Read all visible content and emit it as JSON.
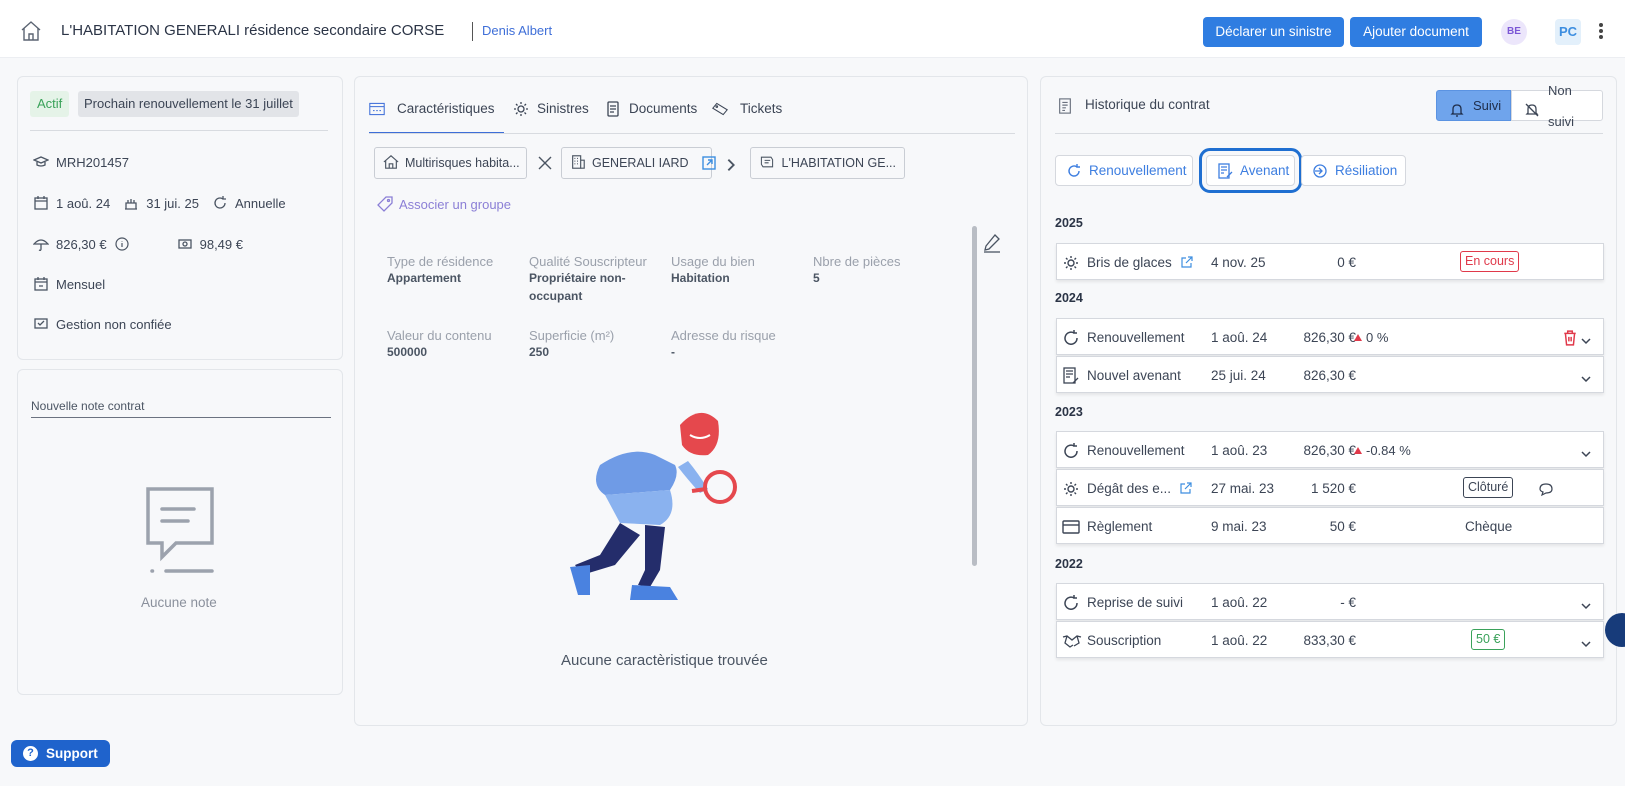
{
  "header": {
    "title": "L'HABITATION GENERALI résidence secondaire CORSE",
    "client": "Denis Albert",
    "declare_button": "Déclarer un sinistre",
    "add_doc_button": "Ajouter document",
    "avatar_1": "BE",
    "avatar_2": "PC"
  },
  "summary": {
    "status": "Actif",
    "renewal": "Prochain renouvellement le 31 juillet",
    "contract_number": "MRH201457",
    "start_date": "1 aoû. 24",
    "end_date": "31 jui. 25",
    "periodicity": "Annuelle",
    "premium": "826,30 €",
    "fees": "98,49 €",
    "payment": "Mensuel",
    "management": "Gestion non confiée"
  },
  "notes": {
    "placeholder": "Nouvelle note contrat",
    "empty": "Aucune note"
  },
  "tabs": [
    {
      "label": "Caractéristiques",
      "icon": "characteristics-icon"
    },
    {
      "label": "Sinistres",
      "icon": "gear-icon"
    },
    {
      "label": "Documents",
      "icon": "document-icon"
    },
    {
      "label": "Tickets",
      "icon": "ticket-icon"
    }
  ],
  "chips": {
    "product": "Multirisques habita...",
    "insurer": "GENERALI IARD",
    "contract": "L'HABITATION GE..."
  },
  "associate_group": "Associer un groupe",
  "fields": [
    {
      "label": "Type de résidence",
      "value": "Appartement"
    },
    {
      "label": "Qualité Souscripteur",
      "value": "Propriétaire non-occupant"
    },
    {
      "label": "Usage du bien",
      "value": "Habitation"
    },
    {
      "label": "Nbre de pièces",
      "value": "5"
    },
    {
      "label": "Valeur du contenu",
      "value": "500000"
    },
    {
      "label": "Superficie (m²)",
      "value": "250"
    },
    {
      "label": "Adresse du risque",
      "value": "-"
    }
  ],
  "empty_characteristics": "Aucune caractèristique trouvée",
  "history": {
    "title": "Historique du contrat",
    "follow": "Suivi",
    "not_follow": "Non suivi",
    "filters": [
      "Renouvellement",
      "Avenant",
      "Résiliation"
    ],
    "years": [
      "2025",
      "2024",
      "2023",
      "2022"
    ],
    "rows": [
      {
        "label": "Bris de glaces",
        "date": "4 nov. 25",
        "amount": "0 €",
        "status": "En cours"
      },
      {
        "label": "Renouvellement",
        "date": "1 aoû. 24",
        "amount": "826,30 €",
        "change": "0 %"
      },
      {
        "label": "Nouvel avenant",
        "date": "25 jui. 24",
        "amount": "826,30 €"
      },
      {
        "label": "Renouvellement",
        "date": "1 aoû. 23",
        "amount": "826,30 €",
        "change": "-0.84 %"
      },
      {
        "label": "Dégât des e...",
        "date": "27 mai. 23",
        "amount": "1 520 €",
        "status": "Clôturé"
      },
      {
        "label": "Règlement",
        "date": "9 mai. 23",
        "amount": "50 €",
        "status": "Chèque"
      },
      {
        "label": "Reprise de suivi",
        "date": "1 aoû. 22",
        "amount": "- €"
      },
      {
        "label": "Souscription",
        "date": "1 aoû. 22",
        "amount": "833,30 €",
        "status": "50 €"
      }
    ]
  },
  "support": "Support",
  "colors": {
    "primary": "#2f7de1",
    "link": "#3d7ee0",
    "danger": "#e0394a",
    "success": "#3aa25a"
  }
}
